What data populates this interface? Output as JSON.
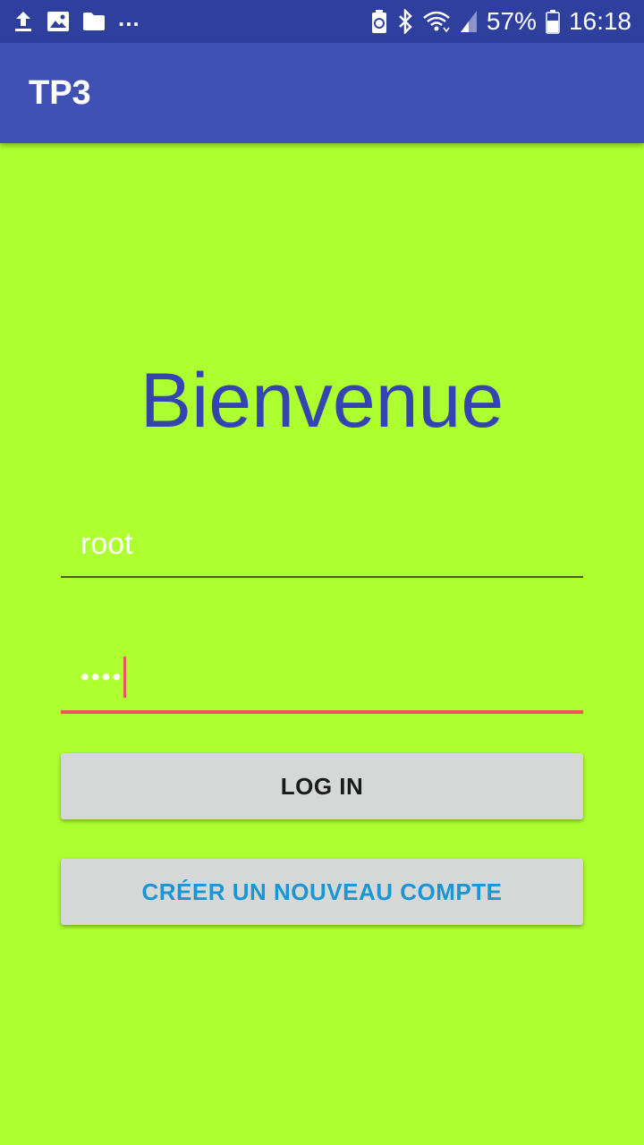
{
  "status_bar": {
    "battery": "57%",
    "time": "16:18",
    "more": "...",
    "icons": [
      "upload-icon",
      "image-icon",
      "folder-icon",
      "battery-saver-icon",
      "bluetooth-icon",
      "wifi-icon",
      "signal-icon",
      "battery-icon"
    ]
  },
  "app_bar": {
    "title": "TP3"
  },
  "main": {
    "welcome": "Bienvenue",
    "username_value": "root",
    "password_value": "••••",
    "login_button": "LOG IN",
    "create_account_button": "CRÉER UN NOUVEAU COMPTE"
  },
  "colors": {
    "background": "#adff2f",
    "app_bar": "#3f51b5",
    "status_bar": "#2f3f9e",
    "welcome_text": "#3445b0",
    "accent": "#ef5560",
    "link_text": "#1a96d4"
  }
}
